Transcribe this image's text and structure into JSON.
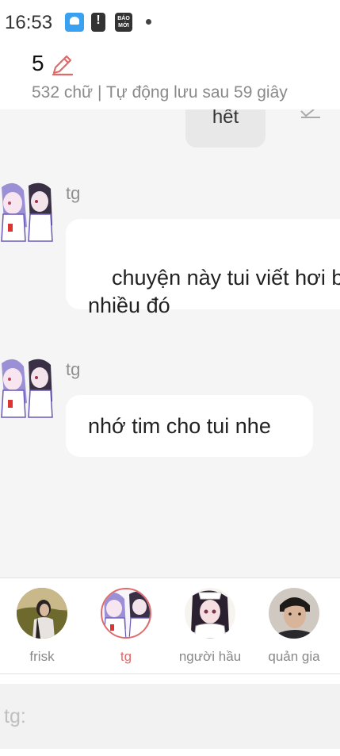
{
  "status_bar": {
    "time": "16:53",
    "icons": [
      "cloud-app-icon",
      "alert-icon",
      "bao-moi-icon",
      "notification-dot-icon"
    ],
    "news_icon_text": "BÁO MỚI"
  },
  "header": {
    "chapter_number": "5",
    "meta": "532 chữ | Tự động lưu sau 59 giây",
    "accent_color": "#e06a6a"
  },
  "messages": [
    {
      "text": "hết"
    },
    {
      "sender": "tg",
      "text": "chuyện này tui viết hơi b\nnhiều đó"
    },
    {
      "sender": "tg",
      "text": "nhớ tim cho tui nhe"
    }
  ],
  "characters": [
    {
      "name": "frisk",
      "active": false
    },
    {
      "name": "tg",
      "active": true
    },
    {
      "name": "người hầu",
      "active": false
    },
    {
      "name": "quản gia",
      "active": false
    }
  ],
  "input": {
    "placeholder": "tg:"
  }
}
